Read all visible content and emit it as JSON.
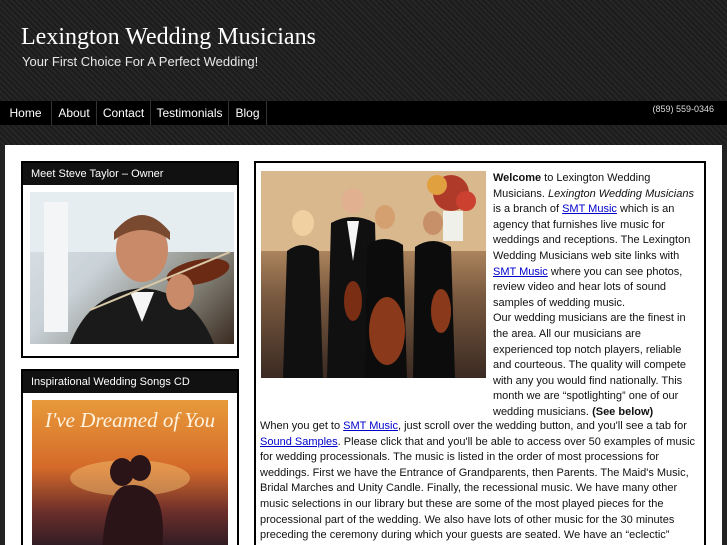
{
  "header": {
    "title": "Lexington Wedding Musicians",
    "tagline": "Your First Choice For A Perfect Wedding!"
  },
  "nav": {
    "items": [
      "Home",
      "About",
      "Contact",
      "Testimonials",
      "Blog"
    ],
    "phone": "(859) 559-0346"
  },
  "sidebar": {
    "owner": {
      "title": "Meet Steve Taylor – Owner",
      "image_desc": "violinist-photo"
    },
    "cd": {
      "title": "Inspirational Wedding Songs CD",
      "cover_text": "I've Dreamed of You"
    }
  },
  "main": {
    "intro_welcome": "Welcome",
    "intro_1": " to Lexington Wedding Musicians. ",
    "intro_italic": "Lexington Wedding Musicians",
    "intro_2": " is a branch of ",
    "link_smt_1": "SMT Music",
    "intro_3": " which is an agency that furnishes live music for weddings and receptions. The Lexington Wedding Musicians web site links with ",
    "link_smt_2": "SMT Music",
    "intro_4": " where you can see photos, review video and hear lots of sound samples of wedding music.",
    "intro_5": "Our wedding musicians are the finest in the area. All our musicians are experienced top notch players, reliable and courteous. The quality will compete with any you would find nationally. This month we are “spotlighting” one of our wedding musicians. ",
    "intro_bold": "(See below)",
    "body_1": "When you get to ",
    "link_smt_3": "SMT Music",
    "body_2": ", just scroll over the wedding button, and you'll see a tab for ",
    "link_sound": "Sound Samples",
    "body_3": ". Please click that and you'll be able to access over 50 examples of music for wedding processionals. The music is listed in the order of most processions for weddings. First we have the Entrance of Grandparents, then Parents. The Maid's Music, Bridal Marches and Unity Candle. Finally, the recessional music. We have many other music selections in our library but these are some of the most played pieces for the processional part of the wedding. We also have lots of other music for the 30 minutes preceding the ceremony during which your guests are seated. We have an “eclectic”"
  }
}
